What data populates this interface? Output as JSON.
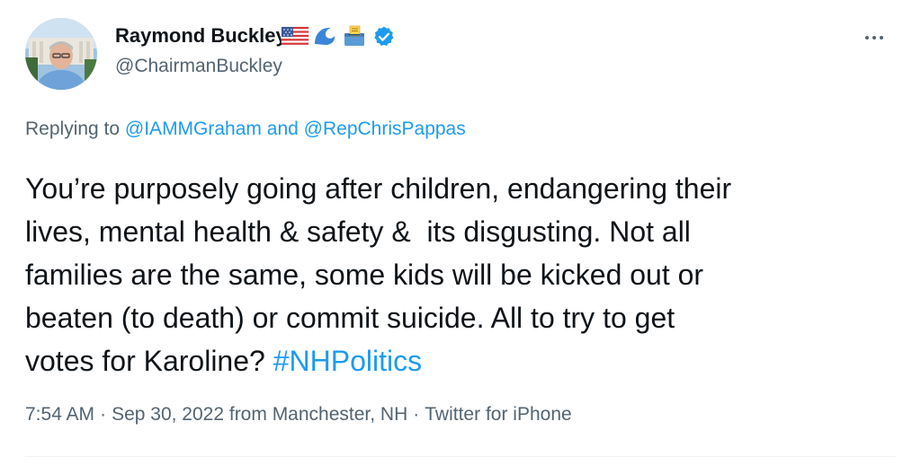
{
  "author": {
    "name": "Raymond Buckley",
    "handle": "@ChairmanBuckley",
    "name_emojis": [
      "us-flag-emoji",
      "wave-emoji",
      "ballot-box-emoji"
    ],
    "verified": true,
    "verified_color": "#1d9bf0"
  },
  "reply": {
    "prefix": "Replying to",
    "mention1": "@IAMMGraham",
    "joiner": "and",
    "mention2": "@RepChrisPappas"
  },
  "tweet": {
    "lines": [
      "You’re purposely going after children, endangering their",
      "lives, mental health & safety &  its disgusting. Not all",
      "families are the same, some kids will be kicked out or",
      "beaten (to death) or commit suicide. All to try to get",
      "votes for Karoline? "
    ],
    "hashtag": "#NHPolitics"
  },
  "meta": {
    "time": "7:54 AM",
    "date": "Sep 30, 2022",
    "location": "from Manchester, NH",
    "source": "Twitter for iPhone",
    "separator": "·"
  },
  "colors": {
    "accent": "#1d9bf0",
    "text": "#0f1419",
    "secondary": "#536471"
  }
}
